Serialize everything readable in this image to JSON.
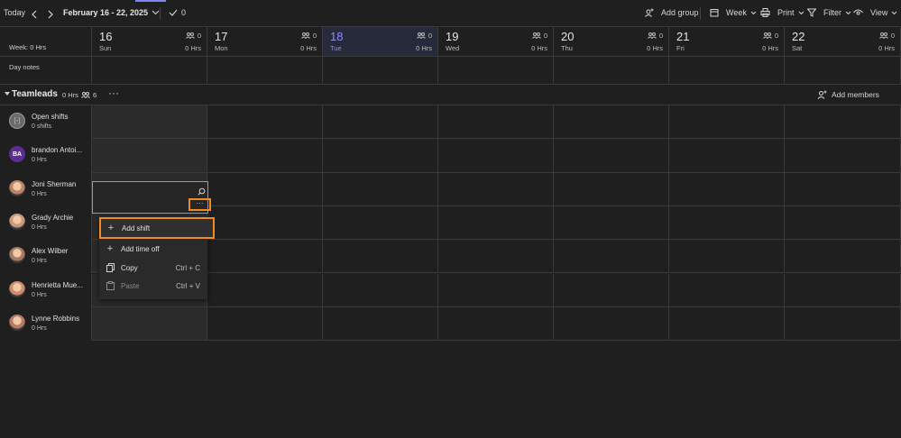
{
  "toolbar": {
    "today": "Today",
    "range": "February 16 - 22, 2025",
    "checks": "0",
    "add_group": "Add group",
    "week": "Week",
    "print": "Print",
    "filter": "Filter",
    "view": "View"
  },
  "header": {
    "week_hours": "Week: 0 Hrs",
    "day_notes": "Day notes",
    "days": [
      {
        "num": "16",
        "wd": "Sun",
        "count": "0",
        "hrs": "0 Hrs"
      },
      {
        "num": "17",
        "wd": "Mon",
        "count": "0",
        "hrs": "0 Hrs"
      },
      {
        "num": "18",
        "wd": "Tue",
        "count": "0",
        "hrs": "0 Hrs"
      },
      {
        "num": "19",
        "wd": "Wed",
        "count": "0",
        "hrs": "0 Hrs"
      },
      {
        "num": "20",
        "wd": "Thu",
        "count": "0",
        "hrs": "0 Hrs"
      },
      {
        "num": "21",
        "wd": "Fri",
        "count": "0",
        "hrs": "0 Hrs"
      },
      {
        "num": "22",
        "wd": "Sat",
        "count": "0",
        "hrs": "0 Hrs"
      }
    ]
  },
  "group": {
    "name": "Teamleads",
    "hours": "0 Hrs",
    "count": "6",
    "more": "···",
    "add_members": "Add members"
  },
  "members": [
    {
      "initials": "",
      "name": "Open shifts",
      "sub": "0 shifts",
      "color": "#8a8a8a"
    },
    {
      "initials": "BA",
      "name": "brandon Antoi...",
      "sub": "0 Hrs",
      "color": "#5c2e91"
    },
    {
      "initials": "",
      "name": "Joni Sherman",
      "sub": "0 Hrs",
      "color": "#b9856a"
    },
    {
      "initials": "",
      "name": "Grady Archie",
      "sub": "0 Hrs",
      "color": "#c89a7a"
    },
    {
      "initials": "",
      "name": "Alex Wilber",
      "sub": "0 Hrs",
      "color": "#a57b63"
    },
    {
      "initials": "",
      "name": "Henrietta Mue...",
      "sub": "0 Hrs",
      "color": "#d08b6f"
    },
    {
      "initials": "",
      "name": "Lynne Robbins",
      "sub": "0 Hrs",
      "color": "#b77a66"
    }
  ],
  "selected_cell": {
    "more": "···"
  },
  "menu": {
    "add_shift": "Add shift",
    "add_time_off": "Add time off",
    "copy": "Copy",
    "copy_shortcut": "Ctrl + C",
    "paste": "Paste",
    "paste_shortcut": "Ctrl + V"
  },
  "colors": {
    "accent": "#7f85f5",
    "highlight": "#f08a24",
    "background": "#1f1f1f"
  }
}
